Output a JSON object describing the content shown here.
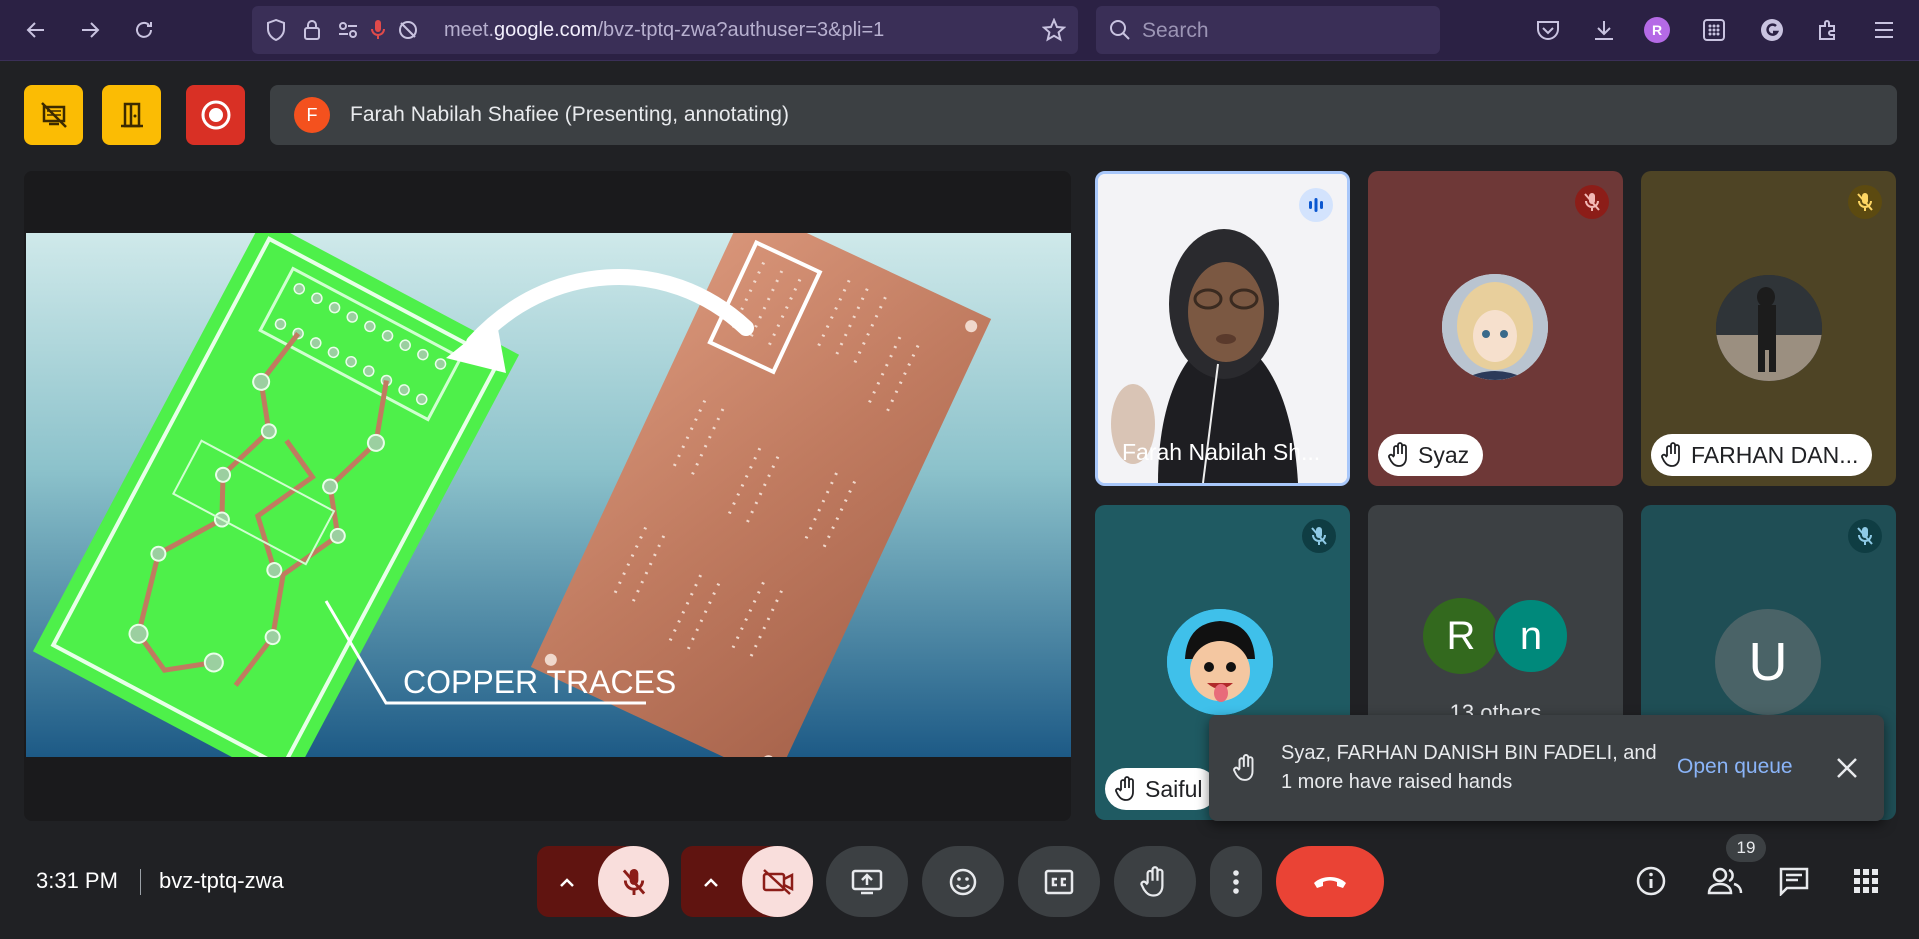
{
  "browser": {
    "url_prefix": "meet.",
    "url_domain": "google.com",
    "url_path": "/bvz-tptq-zwa?authuser=3&pli=1",
    "search_placeholder": "Search",
    "profile_initial": "R"
  },
  "meeting": {
    "presenter_initial": "F",
    "presenting_text": "Farah Nabilah Shafiee (Presenting, annotating)",
    "time": "3:31 PM",
    "code": "bvz-tptq-zwa",
    "participant_count": "19"
  },
  "slide": {
    "caption": "COPPER TRACES"
  },
  "tiles": {
    "farah": {
      "name": "Farah Nabilah Sh..."
    },
    "syaz": {
      "name": "Syaz"
    },
    "farhan": {
      "name": "FARHAN DAN..."
    },
    "saiful": {
      "name": "Saiful"
    },
    "others": {
      "initial_1": "R",
      "initial_2": "n",
      "label": "13 others"
    },
    "u": {
      "initial": "U"
    }
  },
  "toast": {
    "message": "Syaz, FARHAN DANISH BIN FADELI, and 1 more have raised hands",
    "action": "Open queue"
  },
  "colors": {
    "host_control_yellow": "#fbbc04",
    "recording_red": "#d93025",
    "end_call_red": "#ea4335",
    "muted_control_bg": "#f9dedc",
    "link_blue": "#8ab4f8"
  }
}
